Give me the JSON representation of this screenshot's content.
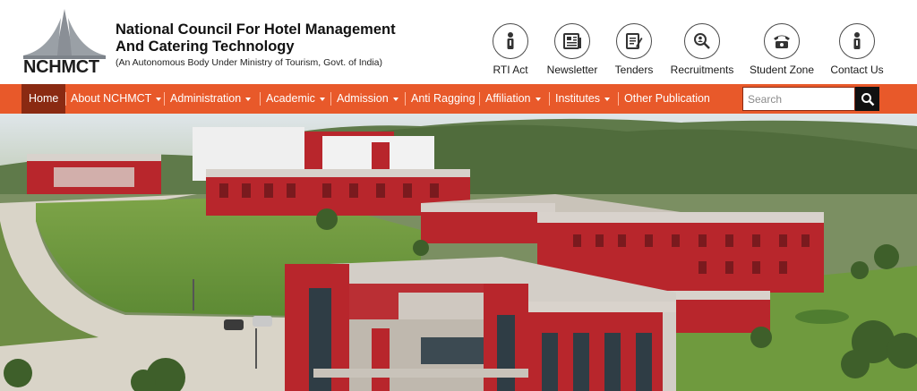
{
  "header": {
    "logo_text": "NCHMCT",
    "title_line1": "National Council For Hotel Management",
    "title_line2": "And Catering Technology",
    "subtitle": "(An Autonomous Body Under Ministry of Tourism, Govt. of India)"
  },
  "quick_links": [
    {
      "label": "RTI Act",
      "icon": "info-person-icon"
    },
    {
      "label": "Newsletter",
      "icon": "newspaper-icon"
    },
    {
      "label": "Tenders",
      "icon": "document-pen-icon"
    },
    {
      "label": "Recruitments",
      "icon": "search-person-icon"
    },
    {
      "label": "Student Zone",
      "icon": "telephone-icon"
    },
    {
      "label": "Contact Us",
      "icon": "info-person-icon"
    }
  ],
  "nav": {
    "items": [
      {
        "label": "Home",
        "active": true,
        "dropdown": false
      },
      {
        "label": "About NCHMCT",
        "dropdown": true
      },
      {
        "label": "Administration",
        "dropdown": true
      },
      {
        "label": "Academic",
        "dropdown": true
      },
      {
        "label": "Admission",
        "dropdown": true
      },
      {
        "label": "Anti Ragging",
        "dropdown": false
      },
      {
        "label": "Affiliation",
        "dropdown": true
      },
      {
        "label": "Institutes",
        "dropdown": true
      },
      {
        "label": "Other Publication",
        "dropdown": false
      }
    ]
  },
  "search": {
    "placeholder": "Search",
    "value": ""
  },
  "colors": {
    "nav_bg": "#e8592a",
    "nav_active": "#8a2a12",
    "building_red": "#b8262c",
    "lawn_green": "#6f9a3e"
  }
}
